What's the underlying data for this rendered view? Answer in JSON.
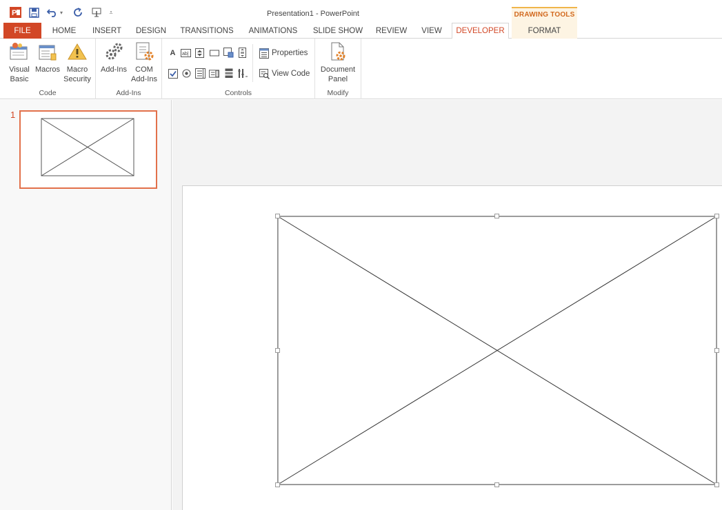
{
  "window": {
    "title": "Presentation1 - PowerPoint",
    "contextual_group": "DRAWING TOOLS"
  },
  "quick_access": [
    {
      "name": "powerpoint-logo-icon"
    },
    {
      "name": "save-icon"
    },
    {
      "name": "undo-icon"
    },
    {
      "name": "redo-icon"
    },
    {
      "name": "touch-mode-icon"
    },
    {
      "name": "customize-qat-icon"
    }
  ],
  "tabs": {
    "file": "FILE",
    "home": "HOME",
    "insert": "INSERT",
    "design": "DESIGN",
    "transitions": "TRANSITIONS",
    "animations": "ANIMATIONS",
    "slideshow": "SLIDE SHOW",
    "review": "REVIEW",
    "view": "VIEW",
    "developer": "DEVELOPER",
    "format": "FORMAT",
    "active": "DEVELOPER"
  },
  "ribbon": {
    "code": {
      "label": "Code",
      "visual_basic_line1": "Visual",
      "visual_basic_line2": "Basic",
      "macros": "Macros",
      "macro_security_line1": "Macro",
      "macro_security_line2": "Security"
    },
    "addins": {
      "label": "Add-Ins",
      "addins": "Add-Ins",
      "com_line1": "COM",
      "com_line2": "Add-Ins"
    },
    "controls": {
      "label": "Controls",
      "label_control_glyph": "A",
      "properties": "Properties",
      "view_code": "View Code"
    },
    "modify": {
      "label": "Modify",
      "document_line1": "Document",
      "document_line2": "Panel"
    }
  },
  "slides_pane": {
    "slide_number": "1"
  },
  "colors": {
    "accent": "#d24726",
    "contextual": "#f0b54a",
    "thumb_border": "#e2704a"
  }
}
